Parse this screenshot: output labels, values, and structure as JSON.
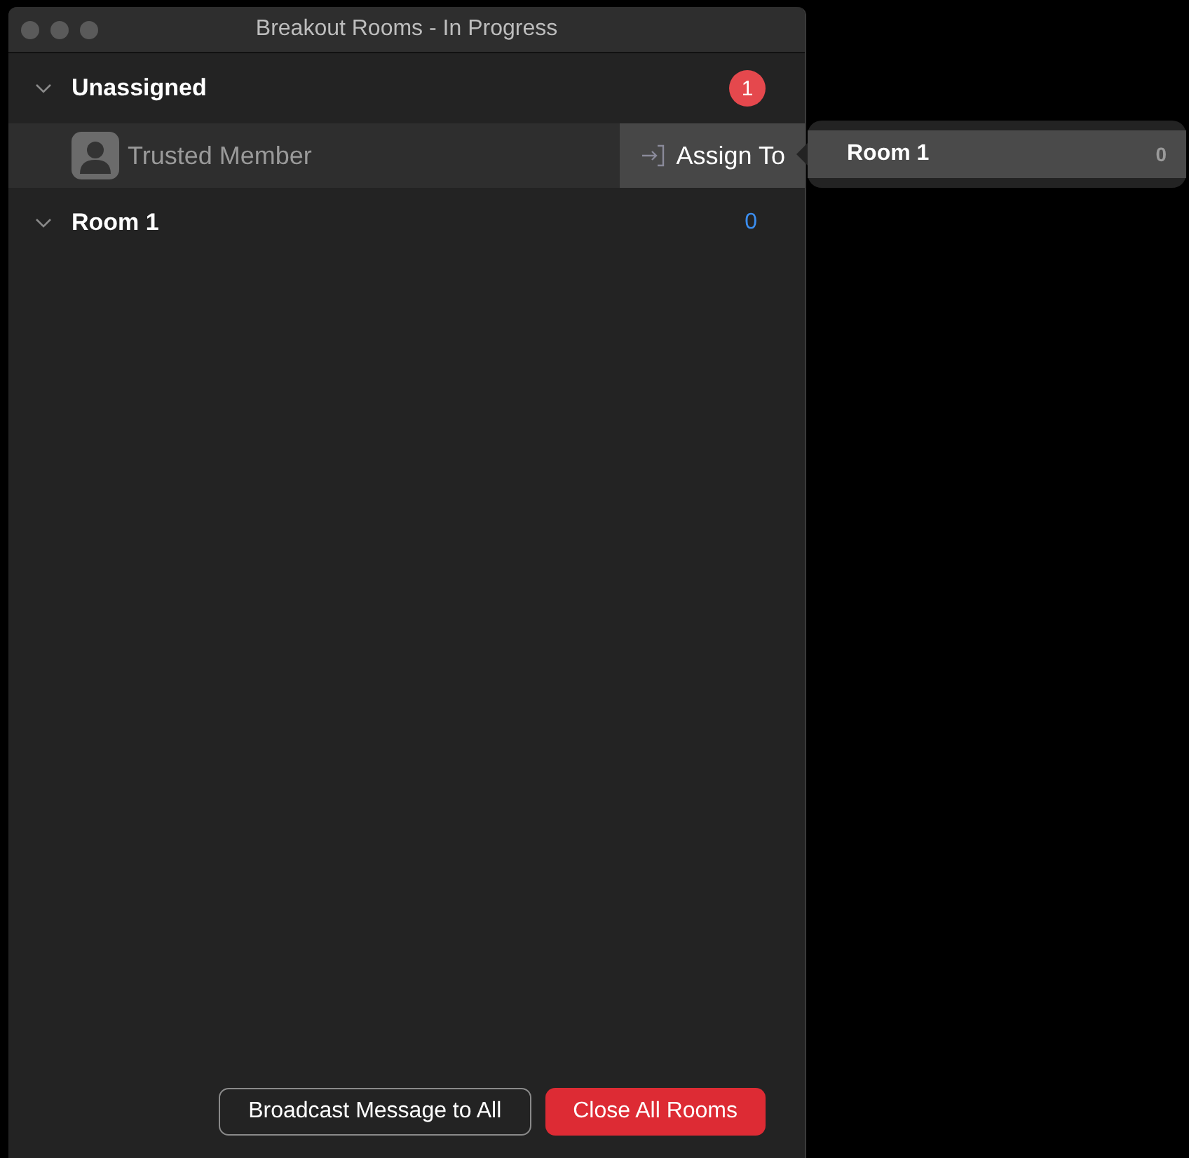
{
  "window": {
    "title": "Breakout Rooms - In Progress"
  },
  "groups": [
    {
      "kind": "badge",
      "name": "Unassigned",
      "count": "1",
      "expanded": true,
      "members": [
        {
          "name": "Trusted Member",
          "hovered": true,
          "action": "Assign To"
        }
      ]
    },
    {
      "kind": "plain",
      "name": "Room 1",
      "count": "0",
      "expanded": true
    }
  ],
  "assign_menu": {
    "items": [
      {
        "name": "Room 1",
        "count": "0"
      }
    ]
  },
  "buttons": [
    {
      "kind": "outline",
      "label": "Broadcast Message to All"
    },
    {
      "kind": "danger",
      "label": "Close All Rooms"
    }
  ]
}
